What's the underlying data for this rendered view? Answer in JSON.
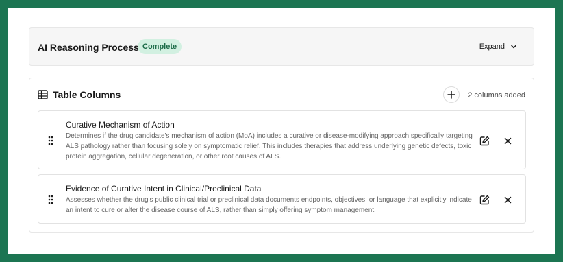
{
  "reasoning": {
    "title": "AI Reasoning Process",
    "status": "Complete",
    "expand_label": "Expand",
    "icon": "chevron-down-icon"
  },
  "table_columns": {
    "title": "Table Columns",
    "icon": "table-icon",
    "add_icon": "plus-icon",
    "count_label": "2 columns added",
    "items": [
      {
        "title": "Curative Mechanism of Action",
        "description": "Determines if the drug candidate's mechanism of action (MoA) includes a curative or disease-modifying approach specifically targeting ALS pathology rather than focusing solely on symptomatic relief. This includes therapies that address underlying genetic defects, toxic protein aggregation, cellular degeneration, or other root causes of ALS."
      },
      {
        "title": "Evidence of Curative Intent in Clinical/Preclinical Data",
        "description": "Assesses whether the drug's public clinical trial or preclinical data documents endpoints, objectives, or language that explicitly indicate an intent to cure or alter the disease course of ALS, rather than simply offering symptom management."
      }
    ]
  },
  "colors": {
    "frame_border": "#1c7552",
    "badge_bg": "#d2f0e1",
    "badge_text": "#1c6b48"
  }
}
